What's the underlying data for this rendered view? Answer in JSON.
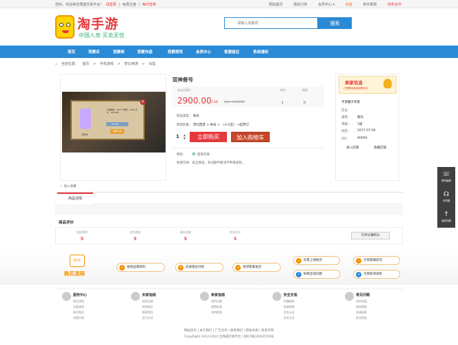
{
  "topbar": {
    "welcome": "您好，欢迎来亞瑪遜交易平台！",
    "login": "请登录",
    "register": "免费注册",
    "daily": "每日签到",
    "links": [
      "网站首页",
      "我的订单",
      "会员中心 ▾",
      "充值",
      "新手帮助",
      "商务合作"
    ]
  },
  "logo": {
    "title": "淘手游",
    "subtitle": "中国人寿 买卖无忧"
  },
  "search": {
    "placeholder": "请输入关键词",
    "button": "搜索"
  },
  "nav": [
    "首页",
    "我要买",
    "我要卖",
    "我要充值",
    "我要提现",
    "会员中心",
    "客服验证",
    "系统通知"
  ],
  "breadcrumb": [
    "当前位置：",
    "首页",
    ">",
    "手机游戏",
    ">",
    "梦幻西游",
    ">",
    "出售"
  ],
  "gallery": {
    "text": "人物等级：69/17 体质：1256 点卡：365/000",
    "gold": "57455",
    "button": "查看人物",
    "caption": "天帝城"
  },
  "product": {
    "title": "双神兽号",
    "labels": {
      "price": "本站优惠价",
      "stock": "库存",
      "sales": "销量"
    },
    "price": "2900.00",
    "discount": "1.0折",
    "original": "原价：2900000",
    "stock": "1",
    "sales": "0",
    "category_label": "商品类型：",
    "category": "帐号",
    "area_label": "游戏区服：",
    "area": "梦幻西游 > 帐号 > （十三区）一起梦幻",
    "qty": "1",
    "buy": "立即购买",
    "cart": "加入购物车",
    "feature_label": "特色：",
    "feature": "担保交易",
    "note": "担保交易、安全保证、有问题不解决不申请退款。"
  },
  "seller": {
    "banner_title": "卖家信息",
    "banner_sub": "已签署消费者保障协议",
    "name": "手游魔子商家",
    "rows": [
      {
        "k": "店主：",
        "v": ""
      },
      {
        "k": "掌柜：",
        "v": "聊天"
      },
      {
        "k": "等级：",
        "v": "1级"
      },
      {
        "k": "创店：",
        "v": "2017-07-28"
      },
      {
        "k": "QQ：",
        "v": "66666"
      }
    ],
    "enter": "进入店铺",
    "collect": "收藏店铺"
  },
  "favorite": "加入收藏",
  "tab": "商品详情",
  "eval": {
    "title": "商品评价",
    "items": [
      {
        "label": "描述相符",
        "value": "5"
      },
      {
        "label": "发货速度",
        "value": "5"
      },
      {
        "label": "服务态度",
        "value": "5"
      },
      {
        "label": "综合评分",
        "value": "5"
      }
    ],
    "write": "写评价赚积分"
  },
  "flow": {
    "badge": "BUY",
    "label": "购买流程",
    "steps": [
      "拍商品填资料",
      "去收银台付款",
      "等待客服发货",
      "买家上线收货",
      "如果出现问题",
      "交易圆满成功",
      "交易取消退款"
    ]
  },
  "footer": [
    {
      "title": "服务中心",
      "items": [
        "购买流程",
        "注册流程",
        "账号购买",
        "充值付款"
      ]
    },
    {
      "title": "买家指南",
      "items": [
        "如何注册",
        "如何购买",
        "搜索商品",
        "支付方式"
      ]
    },
    {
      "title": "卖家指南",
      "items": [
        "如何出售",
        "收费标准",
        "如何提现",
        ""
      ]
    },
    {
      "title": "安全交易",
      "items": [
        "防骗指南",
        "防盗指南",
        "实名认证",
        "实名认证"
      ]
    },
    {
      "title": "常见问题",
      "items": [
        "如何充值",
        "如何提现",
        "申请退款",
        "安全提现"
      ]
    }
  ],
  "bottom": {
    "links": "网站首页 | 关于我们 | 广告合作 | 联系我们 | 隐私条款 | 免责声明",
    "copy": "CopyRight 2014-2024 亞瑪遜交易平台 | 浙ICP备16016550号"
  },
  "side": [
    "联系客服",
    "手机端",
    "返回顶部"
  ]
}
